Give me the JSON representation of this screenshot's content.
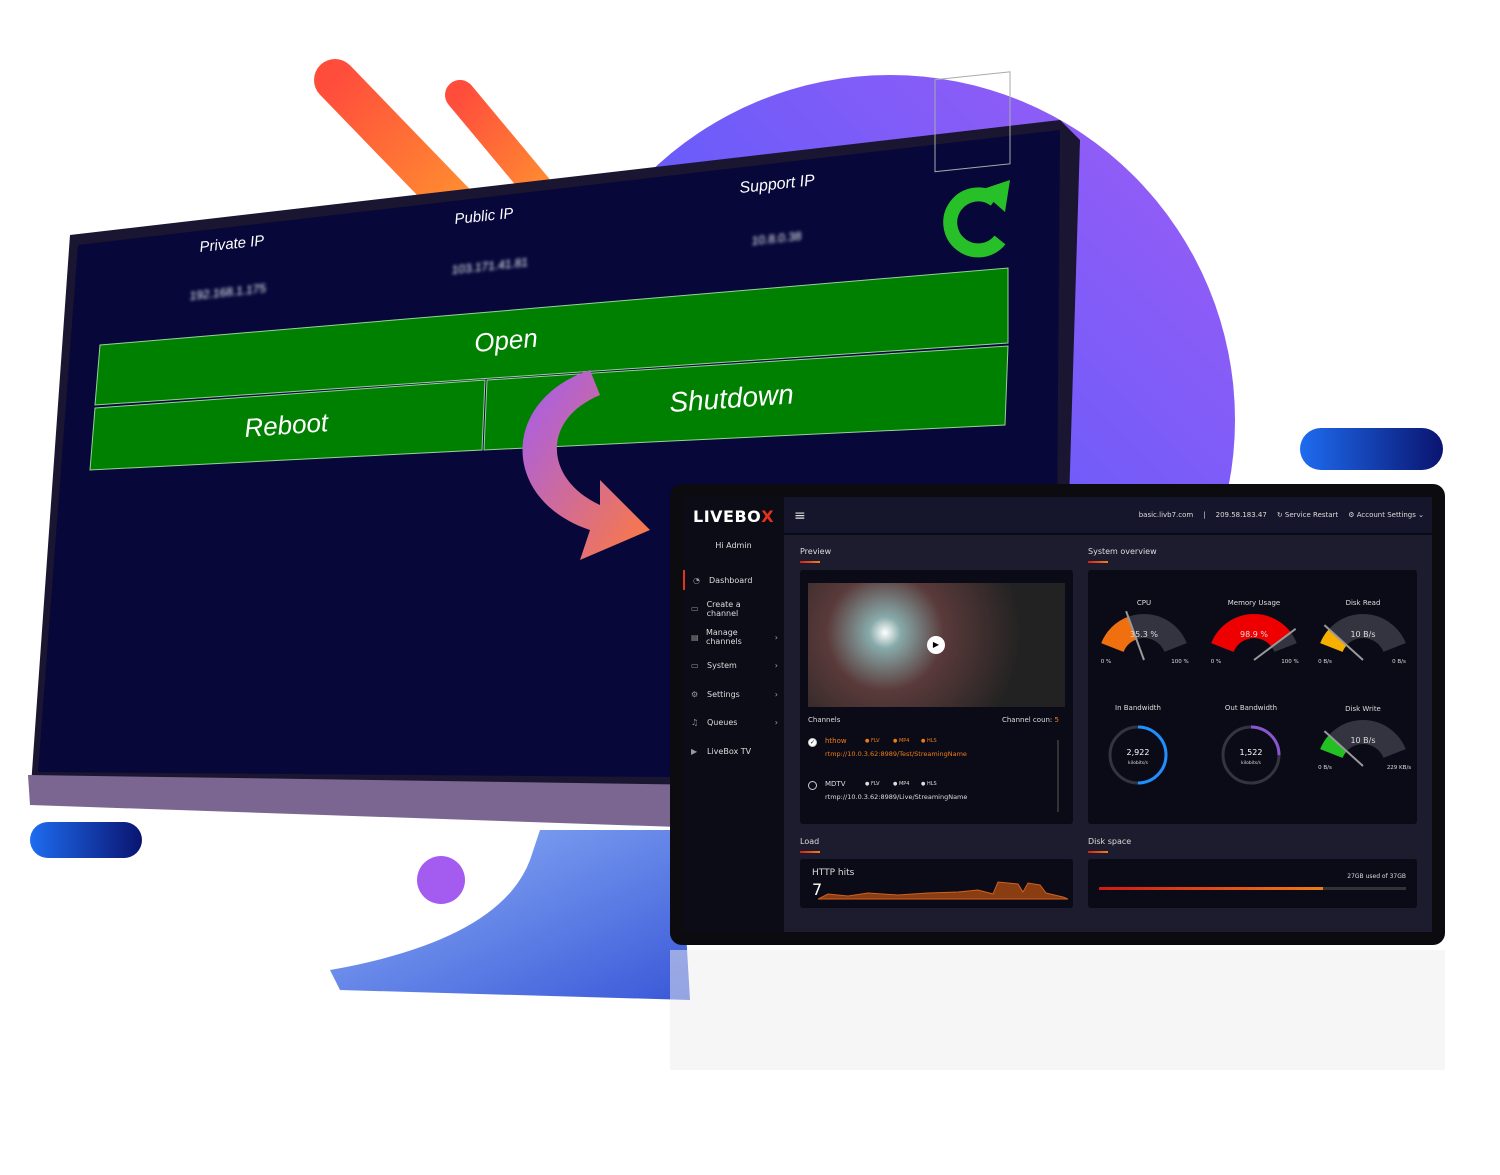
{
  "monitor": {
    "headers": [
      "Private IP",
      "Public IP",
      "Support IP"
    ],
    "ips": [
      "192.168.1.175",
      "103.171.41.81",
      "10.8.0.38"
    ],
    "buttons": {
      "open": "Open",
      "reboot": "Reboot",
      "shutdown": "Shutdown"
    },
    "refresh_icon": "refresh-icon"
  },
  "colors": {
    "accent": "#e5331b",
    "orange": "#f07c14",
    "green_button": "#008000",
    "screen": "#07073a"
  },
  "dashboard": {
    "logo": "LIVEB",
    "logo_o": "O",
    "logo_x": "X",
    "header": {
      "host": "basic.livb7.com",
      "sep": "|",
      "ip": "209.58.183.47",
      "service_restart": "Service Restart",
      "account_settings": "Account Settings"
    },
    "greeting": "Hi Admin",
    "nav": [
      {
        "label": "Dashboard",
        "icon": "gauge-icon",
        "glyph": "◔",
        "chev": ""
      },
      {
        "label": "Create a channel",
        "icon": "monitor-icon",
        "glyph": "▭",
        "chev": ""
      },
      {
        "label": "Manage channels",
        "icon": "list-icon",
        "glyph": "▤",
        "chev": "›"
      },
      {
        "label": "System",
        "icon": "desktop-icon",
        "glyph": "▭",
        "chev": "›"
      },
      {
        "label": "Settings",
        "icon": "gear-icon",
        "glyph": "⚙",
        "chev": "›"
      },
      {
        "label": "Queues",
        "icon": "music-icon",
        "glyph": "♫",
        "chev": "›"
      },
      {
        "label": "LiveBox TV",
        "icon": "play-icon",
        "glyph": "▶",
        "chev": ""
      }
    ],
    "preview": {
      "title": "Preview",
      "channels_label": "Channels",
      "channel_count_label": "Channel coun:",
      "channel_count": "5",
      "channels": [
        {
          "name": "hthow",
          "formats": [
            "FLV",
            "MP4",
            "HLS"
          ],
          "url": "rtmp://10.0.3.62:8989/Test/StreamingName",
          "selected": true
        },
        {
          "name": "MDTV",
          "formats": [
            "FLV",
            "MP4",
            "HLS"
          ],
          "url": "rtmp://10.0.3.62:8989/Live/StreamingName",
          "selected": false
        }
      ]
    },
    "system": {
      "title": "System overview",
      "gauges": [
        {
          "label": "CPU",
          "value": "35.3 %",
          "min": "0 %",
          "max": "100 %",
          "fraction": 0.353,
          "color": "#f07010"
        },
        {
          "label": "Memory Usage",
          "value": "98.9 %",
          "min": "0 %",
          "max": "100 %",
          "fraction": 0.889,
          "color": "#ee0000"
        },
        {
          "label": "Disk Read",
          "value": "10 B/s",
          "min": "0 B/s",
          "max": "0 B/s",
          "fraction": 0.15,
          "color": "#f8b000"
        },
        {
          "label": "Disk Write",
          "value": "10 B/s",
          "min": "0 B/s",
          "max": "229 KB/s",
          "fraction": 0.15,
          "color": "#22c022"
        }
      ],
      "rings": [
        {
          "label": "In Bandwidth",
          "value": "2,922",
          "unit": "kilobits/s",
          "fraction": 0.5,
          "color": "#1e90ff"
        },
        {
          "label": "Out Bandwidth",
          "value": "1,522",
          "unit": "kilobits/s",
          "fraction": 0.25,
          "color": "#8a55d0"
        }
      ]
    },
    "load": {
      "title": "Load",
      "label": "HTTP hits",
      "value": "7"
    },
    "disk": {
      "title": "Disk space",
      "text": "27GB used of 37GB",
      "fraction": 0.73
    }
  }
}
